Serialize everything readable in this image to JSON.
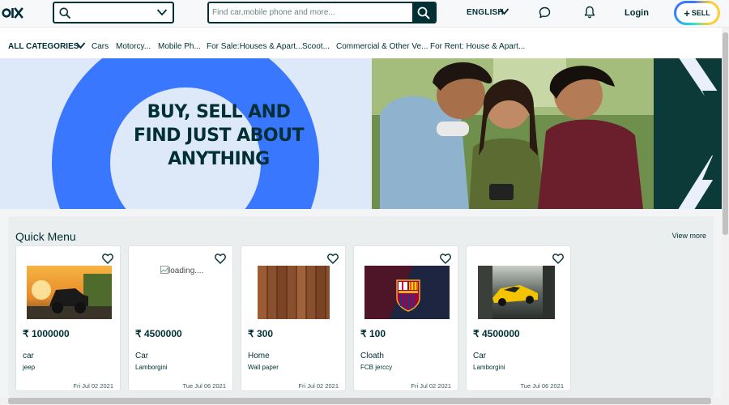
{
  "header": {
    "logo_text": "OLX",
    "search_placeholder": "Find car,mobile phone and more...",
    "language": "ENGLISH",
    "login": "Login",
    "sell": "SELL"
  },
  "categories": {
    "all_label": "ALL CATEGORIES",
    "items": [
      "Cars",
      "Motorcy...",
      "Mobile Ph...",
      "For Sale:Houses & Apart...",
      "Scoot...",
      "Commercial & Other Ve...",
      "For Rent: House & Apart..."
    ]
  },
  "banner": {
    "line1": "BUY, SELL AND",
    "line2": "FIND JUST ABOUT",
    "line3": "ANYTHING",
    "colors": {
      "ring": "#3a77ff",
      "background": "#dde9f9",
      "panel": "#0c3a39"
    }
  },
  "quick_menu": {
    "title": "Quick Menu",
    "view_more": "View more",
    "cards": [
      {
        "image_icon": "pickup-truck-photo",
        "price": "₹ 1000000",
        "title": "car",
        "subtitle": "jeep",
        "date": "Fri Jul 02 2021"
      },
      {
        "image_icon": "broken-image",
        "image_alt": "loading....",
        "price": "₹ 4500000",
        "title": "Car",
        "subtitle": "Lamborgini",
        "date": "Tue Jul 06 2021"
      },
      {
        "image_icon": "wood-planks-photo",
        "price": "₹ 300",
        "title": "Home",
        "subtitle": "Wall paper",
        "date": "Fri Jul 02 2021"
      },
      {
        "image_icon": "fcb-crest-photo",
        "price": "₹ 100",
        "title": "Cloath",
        "subtitle": "FCB jerccy",
        "date": "Fri Jul 02 2021"
      },
      {
        "image_icon": "yellow-sports-car-photo",
        "price": "₹ 4500000",
        "title": "Car",
        "subtitle": "Lamborgini",
        "date": "Tue Jul 06 2021"
      }
    ]
  }
}
